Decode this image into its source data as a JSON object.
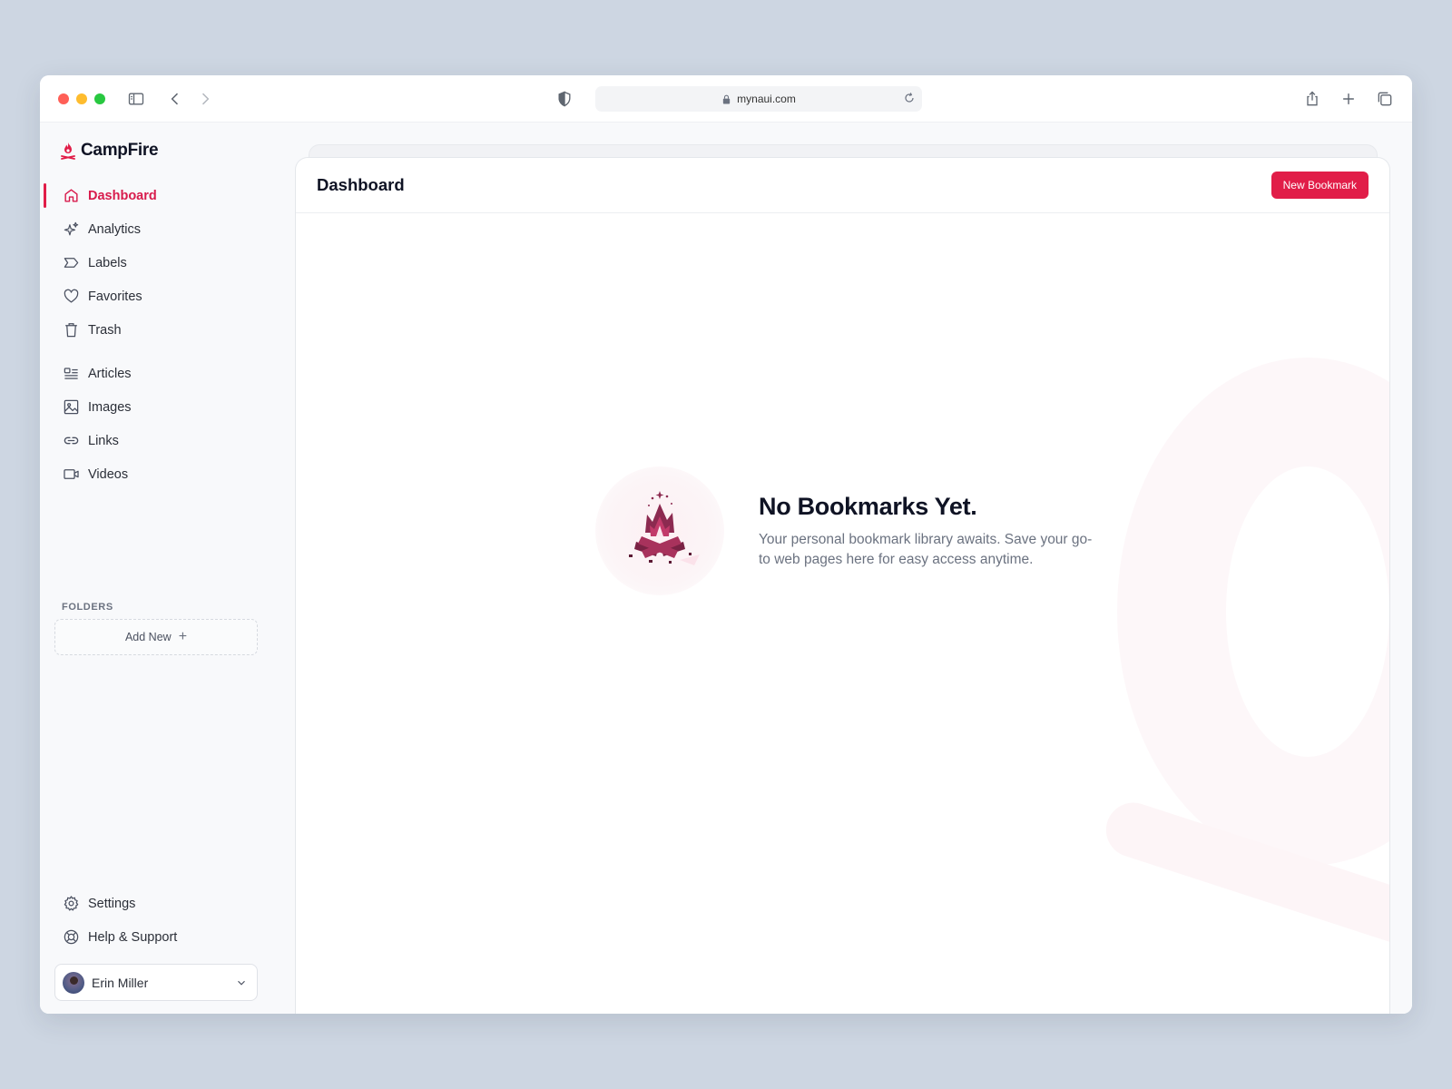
{
  "browser": {
    "url": "mynaui.com",
    "icons": [
      "sidebar-toggle-icon",
      "back-icon",
      "forward-icon",
      "shield-icon",
      "lock-icon",
      "reload-icon",
      "share-icon",
      "new-tab-icon",
      "tabs-icon"
    ]
  },
  "brand": {
    "name": "CampFire",
    "icon": "flame-icon"
  },
  "sidebar": {
    "primary": [
      {
        "label": "Dashboard",
        "icon": "home-icon"
      },
      {
        "label": "Analytics",
        "icon": "sparkles-icon"
      },
      {
        "label": "Labels",
        "icon": "label-icon"
      },
      {
        "label": "Favorites",
        "icon": "heart-icon"
      },
      {
        "label": "Trash",
        "icon": "trash-icon"
      }
    ],
    "secondary": [
      {
        "label": "Articles",
        "icon": "articles-icon"
      },
      {
        "label": "Images",
        "icon": "image-icon"
      },
      {
        "label": "Links",
        "icon": "link-icon"
      },
      {
        "label": "Videos",
        "icon": "video-icon"
      }
    ],
    "folders_label": "FOLDERS",
    "add_new_label": "Add New",
    "bottom": [
      {
        "label": "Settings",
        "icon": "gear-icon"
      },
      {
        "label": "Help & Support",
        "icon": "lifebuoy-icon"
      }
    ],
    "user": {
      "name": "Erin Miller"
    }
  },
  "main": {
    "title": "Dashboard",
    "new_button": "New Bookmark",
    "empty": {
      "title": "No Bookmarks Yet.",
      "description": "Your personal bookmark library awaits. Save your go-to web pages here for easy access anytime."
    }
  },
  "colors": {
    "accent": "#e11d48",
    "text": "#0f1324",
    "muted": "#6b7280"
  }
}
